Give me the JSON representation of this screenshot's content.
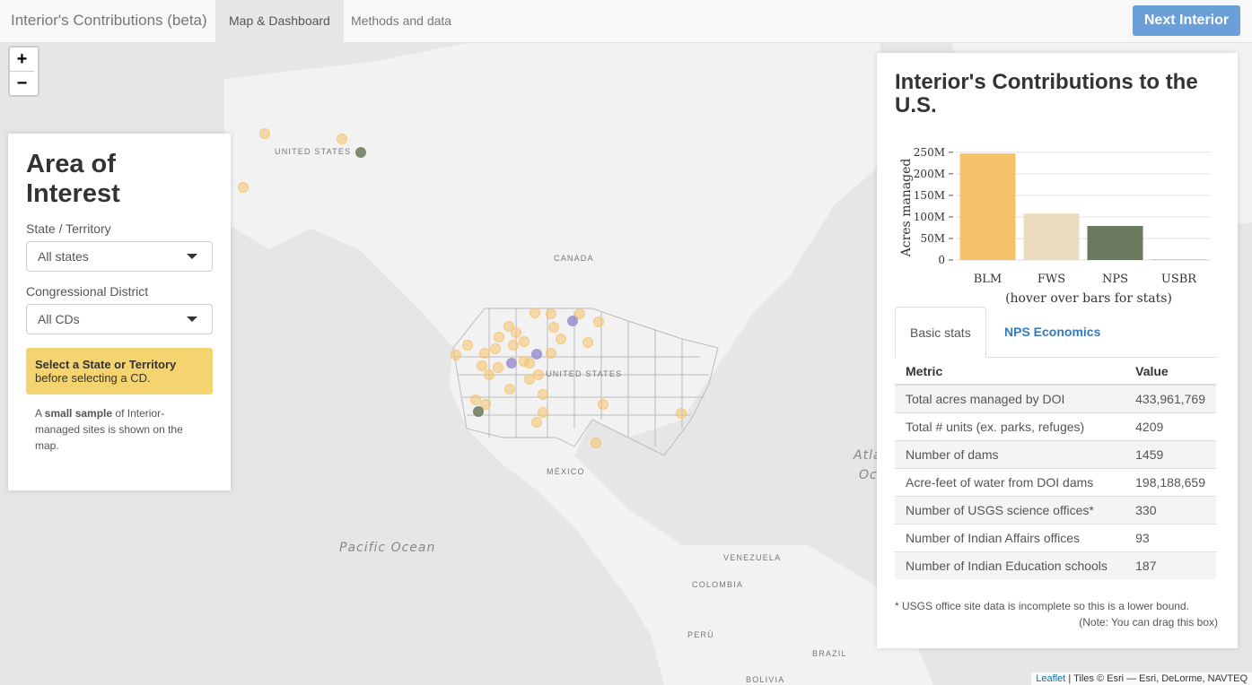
{
  "navbar": {
    "brand": "Interior's Contributions (beta)",
    "tabs": [
      "Map & Dashboard",
      "Methods and data"
    ],
    "next_button": "Next Interior"
  },
  "map": {
    "zoom_in": "+",
    "zoom_out": "−",
    "labels": [
      "UNITED STATES",
      "CANADA",
      "UNITED STATES",
      "MÉXICO",
      "VENEZUELA",
      "COLOMBIA",
      "PERÚ",
      "BRAZIL",
      "BOLIVIA"
    ],
    "ocean_labels": [
      "Pacific Ocean",
      "Atla",
      "Oc"
    ],
    "attribution_link": "Leaflet",
    "attribution_text": " | Tiles © Esri — Esri, DeLorme, NAVTEQ",
    "marker_colors": {
      "blm": "#f5c26b",
      "nps": "#6b7a5e",
      "fws": "#9b8fcf"
    }
  },
  "left_panel": {
    "title": "Area of Interest",
    "state_label": "State / Territory",
    "state_value": "All states",
    "cd_label": "Congressional District",
    "cd_value": "All CDs",
    "warning_bold": "Select a State or Territory",
    "warning_text": "before selecting a CD.",
    "note_prefix": "A ",
    "note_bold": "small sample",
    "note_suffix": " of Interior-managed sites is shown on the map."
  },
  "right_panel": {
    "title": "Interior's Contributions to the U.S.",
    "tabs": [
      "Basic stats",
      "NPS Economics"
    ],
    "table_headers": [
      "Metric",
      "Value"
    ],
    "rows": [
      [
        "Total acres managed by DOI",
        "433,961,769"
      ],
      [
        "Total # units (ex. parks, refuges)",
        "4209"
      ],
      [
        "Number of dams",
        "1459"
      ],
      [
        "Acre-feet of water from DOI dams",
        "198,188,659"
      ],
      [
        "Number of USGS science offices*",
        "330"
      ],
      [
        "Number of Indian Affairs offices",
        "93"
      ],
      [
        "Number of Indian Education schools",
        "187"
      ]
    ],
    "footnote": "* USGS office site data is incomplete so this is a lower bound.",
    "drag_note": "(Note: You can drag this box)"
  },
  "chart_data": {
    "type": "bar",
    "categories": [
      "BLM",
      "FWS",
      "NPS",
      "USBR"
    ],
    "values": [
      247,
      108,
      79,
      2
    ],
    "colors": [
      "#f5c26b",
      "#ecdcbf",
      "#6b7a5e",
      "#c8c3e3"
    ],
    "ylabel": "Acres managed",
    "xlabel": "(hover over bars for stats)",
    "ylim": [
      0,
      260
    ],
    "yticks": [
      0,
      50,
      100,
      150,
      200,
      250
    ],
    "ytick_labels": [
      "0",
      "50M",
      "100M",
      "150M",
      "200M",
      "250M"
    ]
  }
}
